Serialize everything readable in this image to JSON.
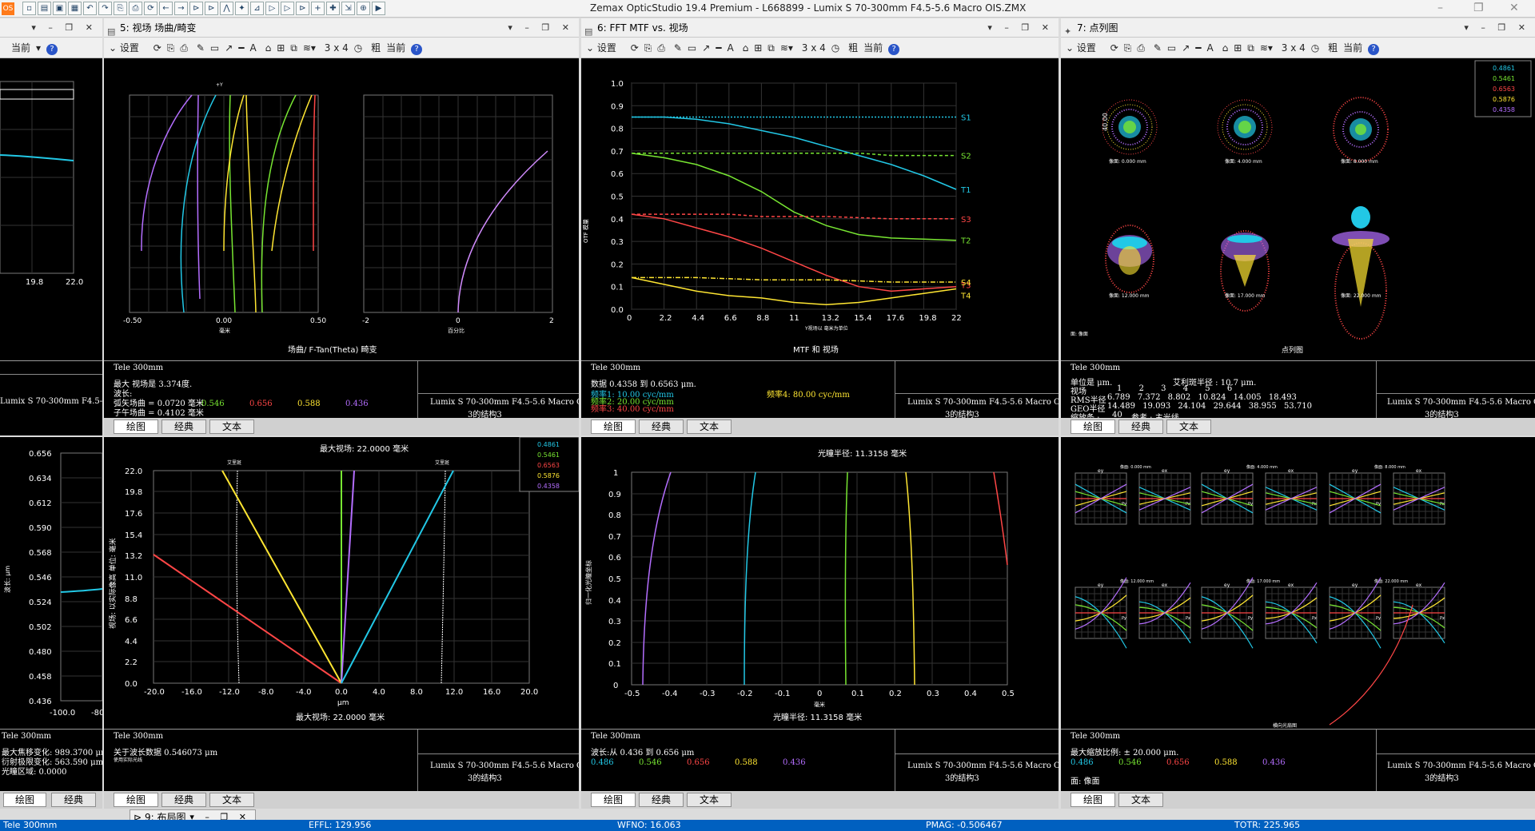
{
  "app": {
    "title": "Zemax OpticStudio 19.4    Premium - L668899 - Lumix S 70-300mm F4.5-5.6 Macro OIS.ZMX",
    "icon_label": "OS"
  },
  "toolbar": {
    "settings": "设置",
    "current": "当前",
    "grid": "3 x 4",
    "coarse": "粗",
    "tab_plot": "绘图",
    "tab_classic": "经典",
    "tab_text": "文本",
    "help": "?"
  },
  "panels": {
    "p5": {
      "title": "5: 视场 场曲/畸变",
      "footer_title": "场曲/ F-Tan(Theta) 畸变",
      "config": "Tele 300mm",
      "line1": "最大 视场是 3.374度.",
      "line2": "波长:",
      "line3": "弧矢场曲 = 0.0720 毫米",
      "line4": "子午场曲 = 0.4102 毫米",
      "file": "Lumix S 70-300mm F4.5-5.6 Macro OIS.ZMX",
      "cfg": "3的结构3",
      "xlabel1": "毫米",
      "xlabel2": "百分比",
      "ticks1": [
        "-0.50",
        "0.00",
        "0.50"
      ],
      "ticks2": [
        "-2",
        "0",
        "2"
      ],
      "top_label": "+Y"
    },
    "p6": {
      "title": "6: FFT MTF vs. 视场",
      "footer_title": "MTF 和 视场",
      "config": "Tele 300mm",
      "line1": "数据 0.4358 到 0.6563 μm.",
      "freq1": "频率1: 10.00 cyc/mm",
      "freq2": "频率2: 20.00 cyc/mm",
      "freq3": "频率3: 40.00 cyc/mm",
      "freq4": "频率4: 80.00 cyc/mm",
      "file": "Lumix S 70-300mm F4.5-5.6 Macro OIS.ZMX",
      "cfg": "3的结构3",
      "ylabel": "OTF 模量",
      "xlabel": "Y视场以 毫米为单位"
    },
    "p7": {
      "title": "7: 点列图",
      "footer_title": "点列图",
      "config": "Tele 300mm",
      "unit": "单位是 μm.",
      "airy": "艾利斑半径 : 10.7 μm.",
      "row_field": "视场",
      "fields": [
        "1",
        "2",
        "3",
        "4",
        "5",
        "6"
      ],
      "row_rms": "RMS半径",
      "rms": [
        "6.789",
        "7.372",
        "8.802",
        "10.824",
        "14.005",
        "18.493"
      ],
      "row_geo": "GEO半径",
      "geo": [
        "14.489",
        "19.093",
        "24.104",
        "29.644",
        "38.955",
        "53.710"
      ],
      "row_scale": "缩放条 :",
      "scale_val": "40",
      "ref": "参考 : 主光线",
      "file": "Lumix S 70-300mm F4.5-5.6 Macro OIS.ZMX",
      "cfg": "3的结构3",
      "field_labels": [
        "像面: 0.000 mm",
        "像面: 4.000 mm",
        "像面: 8.000 mm",
        "像面: 12.000 mm",
        "像面: 17.000 mm",
        "像面: 22.000 mm"
      ],
      "scale_label": "40.00",
      "surface": "面: 像面"
    },
    "p_lat": {
      "config": "Tele 300mm",
      "line1": "最大焦移变化: 989.3700 μm",
      "line2": "衍射极限变化: 563.590 μm",
      "line3": "光瞳区域: 0.0000",
      "ylabel": "波长: μm",
      "yticks": [
        "0.656",
        "0.634",
        "0.612",
        "0.590",
        "0.568",
        "0.546",
        "0.524",
        "0.502",
        "0.480",
        "0.458",
        "0.436"
      ],
      "xticks": [
        "-100.0",
        "-80"
      ]
    },
    "p_top_left": {
      "xticks": [
        "19.8",
        "22.0"
      ],
      "xtick_partial": "8"
    },
    "p_lateral": {
      "title": "最大视场: 22.0000 毫米",
      "footer_title": "最大视场: 22.0000 毫米",
      "config": "Tele 300mm",
      "line1": "关于波长数据 0.546073 μm",
      "line2": "使用实际光线",
      "file": "Lumix S 70-300mm F4.5-5.6 Macro OIS.ZMX",
      "cfg": "3的结构3",
      "ylabel": "视场: 以实际像高 单位: 毫米",
      "xlabel": "μm",
      "airy_left": "艾里斑",
      "airy_right": "艾里斑",
      "yticks": [
        "22.0",
        "19.8",
        "17.6",
        "15.4",
        "13.2",
        "11.0",
        "8.8",
        "6.6",
        "4.4",
        "2.2",
        "0.0"
      ],
      "xticks": [
        "-20.0",
        "-16.0",
        "-12.0",
        "-8.0",
        "-4.0",
        "0.0",
        "4.0",
        "8.0",
        "12.0",
        "16.0",
        "20.0"
      ]
    },
    "p_pupil": {
      "title": "光瞳半径: 11.3158 毫米",
      "footer_title": "光瞳半径: 11.3158 毫米",
      "config": "Tele 300mm",
      "line1": "波长:从 0.436 到 0.656 μm",
      "file": "Lumix S 70-300mm F4.5-5.6 Macro OIS.ZMX",
      "cfg": "3的结构3",
      "ylabel": "归一化光瞳坐标",
      "xlabel": "毫米",
      "yticks": [
        "1",
        "0.9",
        "0.8",
        "0.7",
        "0.6",
        "0.5",
        "0.4",
        "0.3",
        "0.2",
        "0.1",
        "0"
      ],
      "xticks": [
        "-0.5",
        "-0.4",
        "-0.3",
        "-0.2",
        "-0.1",
        "0",
        "0.1",
        "0.2",
        "0.3",
        "0.4",
        "0.5"
      ]
    },
    "p_ray": {
      "config": "Tele 300mm",
      "line1": "最大缩放比例: ± 20.000 μm.",
      "surface": "面: 像面",
      "footer_title": "横向光扇图",
      "file": "Lumix S 70-300mm F4.5-5.6 Macro OIS.ZMX",
      "cfg": "3的结构3",
      "cells": [
        "像面: 0.000 mm",
        "像面: 4.000 mm",
        "像面: 8.000 mm",
        "像面: 12.000 mm",
        "像面: 17.000 mm",
        "像面: 22.000 mm"
      ],
      "ey": "ey",
      "ex": "ex",
      "py": "Py",
      "px": "Px"
    },
    "layout": {
      "title": "9: 布局图"
    }
  },
  "wavelengths": [
    "0.486",
    "0.546",
    "0.656",
    "0.588",
    "0.436"
  ],
  "wave_legend": [
    "0.4861",
    "0.5461",
    "0.6563",
    "0.5876",
    "0.4358"
  ],
  "colors": {
    "blue": "#22c8e6",
    "green": "#78e632",
    "red": "#ff4646",
    "yellow": "#ffe632",
    "violet": "#b46eff"
  },
  "status": {
    "config": "Tele 300mm",
    "effl": "EFFL: 129.956",
    "wfno": "WFNO: 16.063",
    "pmag": "PMAG: -0.506467",
    "totr": "TOTR: 225.965"
  },
  "chart_data": [
    {
      "type": "line",
      "x": [
        0,
        2.2,
        4.4,
        6.6,
        8.8,
        11,
        13.2,
        15.4,
        17.6,
        19.8,
        22
      ],
      "xlim": [
        0,
        22
      ],
      "ylim": [
        0,
        1
      ],
      "xticks": [
        "0",
        "2.2",
        "4.4",
        "6.6",
        "8.8",
        "11",
        "13.2",
        "15.4",
        "17.6",
        "19.8",
        "22"
      ],
      "yticks": [
        "0.0",
        "0.1",
        "0.2",
        "0.3",
        "0.4",
        "0.5",
        "0.6",
        "0.7",
        "0.8",
        "0.9",
        "1.0"
      ],
      "series": [
        {
          "name": "S1",
          "values": [
            0.85,
            0.85,
            0.85,
            0.85,
            0.85,
            0.85,
            0.85,
            0.85,
            0.85,
            0.85,
            0.85
          ]
        },
        {
          "name": "T1",
          "values": [
            0.85,
            0.85,
            0.84,
            0.82,
            0.79,
            0.76,
            0.72,
            0.68,
            0.64,
            0.59,
            0.53
          ]
        },
        {
          "name": "S2",
          "values": [
            0.69,
            0.69,
            0.69,
            0.69,
            0.69,
            0.69,
            0.69,
            0.69,
            0.68,
            0.68,
            0.68
          ]
        },
        {
          "name": "T2",
          "values": [
            0.69,
            0.67,
            0.64,
            0.59,
            0.52,
            0.43,
            0.37,
            0.33,
            0.315,
            0.31,
            0.305
          ]
        },
        {
          "name": "S3",
          "values": [
            0.42,
            0.42,
            0.42,
            0.42,
            0.41,
            0.41,
            0.41,
            0.405,
            0.4,
            0.4,
            0.4
          ]
        },
        {
          "name": "T3",
          "values": [
            0.42,
            0.4,
            0.36,
            0.32,
            0.27,
            0.21,
            0.15,
            0.1,
            0.08,
            0.09,
            0.1
          ]
        },
        {
          "name": "S4",
          "values": [
            0.14,
            0.14,
            0.14,
            0.135,
            0.13,
            0.13,
            0.13,
            0.125,
            0.12,
            0.12,
            0.12
          ]
        },
        {
          "name": "T4",
          "values": [
            0.14,
            0.11,
            0.08,
            0.06,
            0.05,
            0.03,
            0.02,
            0.03,
            0.05,
            0.07,
            0.09
          ]
        }
      ]
    }
  ]
}
